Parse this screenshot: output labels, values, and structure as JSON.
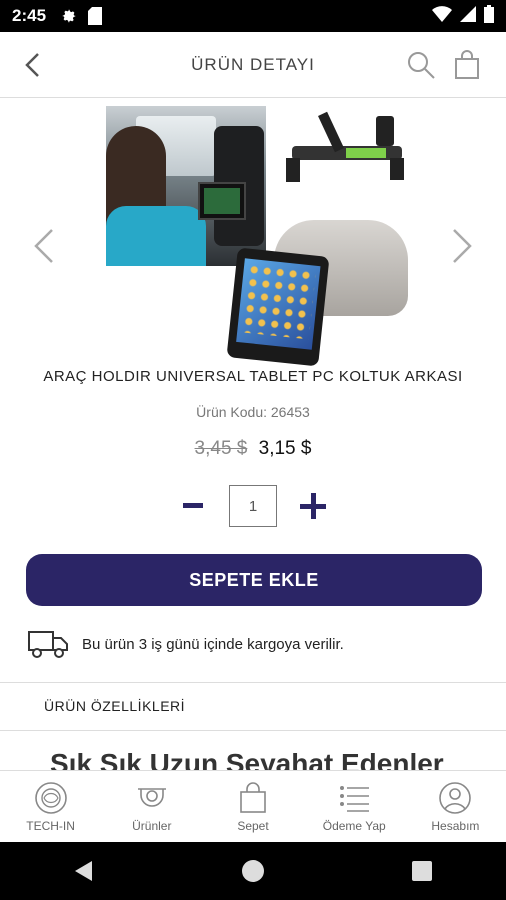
{
  "status_bar": {
    "time": "2:45",
    "icons": [
      "settings-icon",
      "sd-card-icon",
      "wifi-icon",
      "signal-icon",
      "battery-icon"
    ]
  },
  "header": {
    "title": "ÜRÜN DETAYI",
    "icons": [
      "back-icon",
      "search-icon",
      "shopping-bag-icon"
    ]
  },
  "product": {
    "name": "ARAÇ HOLDIR UNIVERSAL TABLET PC KOLTUK ARKASI",
    "code_label": "Ürün Kodu:",
    "code": "26453",
    "old_price": "3,45 $",
    "price": "3,15 $",
    "quantity": "1"
  },
  "cta": {
    "label": "SEPETE EKLE"
  },
  "shipping": {
    "text": "Bu ürün 3 iş günü içinde kargoya verilir."
  },
  "features": {
    "label": "ÜRÜN ÖZELLİKLERİ"
  },
  "description_peek": "Sık Sık Uzun Seyahat Edenler",
  "bottom_nav": {
    "items": [
      {
        "label": "TECH-IN",
        "icon": "tech-in-logo-icon"
      },
      {
        "label": "Ürünler",
        "icon": "products-icon"
      },
      {
        "label": "Sepet",
        "icon": "cart-bag-icon"
      },
      {
        "label": "Ödeme Yap",
        "icon": "checkout-list-icon"
      },
      {
        "label": "Hesabım",
        "icon": "account-icon"
      }
    ]
  },
  "colors": {
    "primary": "#2b2566",
    "divider": "#dddddd",
    "text": "#222222"
  }
}
